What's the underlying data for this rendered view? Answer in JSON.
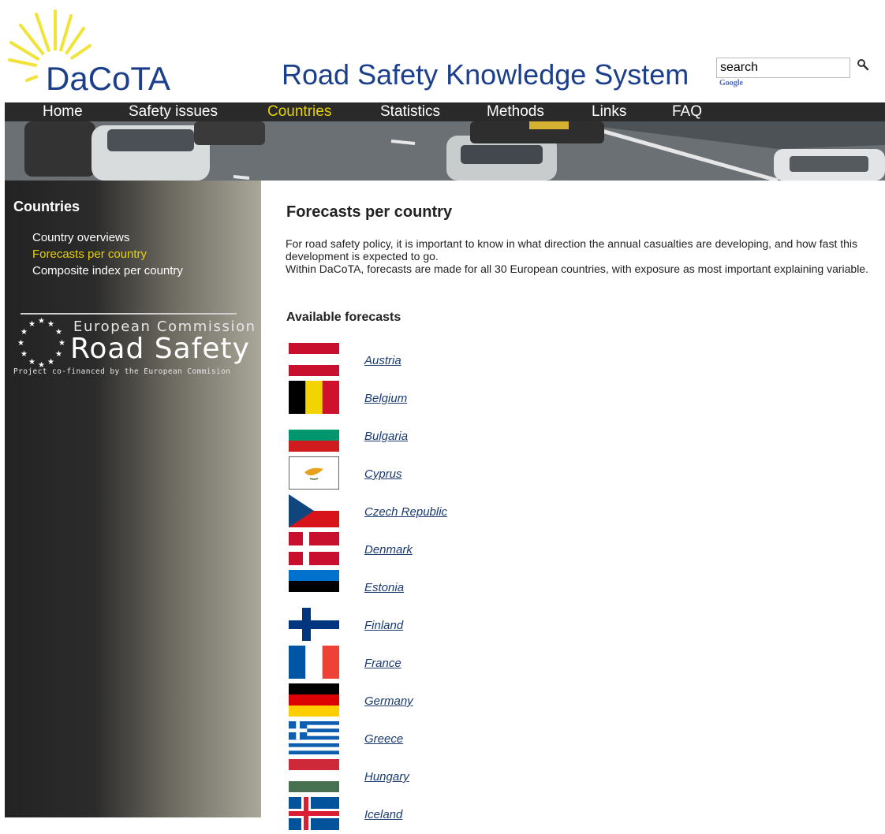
{
  "header": {
    "logo_text": "DaCoTA",
    "site_title": "Road Safety Knowledge System",
    "search": {
      "value": "search",
      "provider": "Google",
      "icon": "search-icon"
    }
  },
  "nav": {
    "items": [
      {
        "label": "Home"
      },
      {
        "label": "Safety issues"
      },
      {
        "label": "Countries",
        "active": true
      },
      {
        "label": "Statistics"
      },
      {
        "label": "Methods"
      },
      {
        "label": "Links"
      },
      {
        "label": "FAQ"
      }
    ],
    "active_color": "#e8d200"
  },
  "sidebar": {
    "title": "Countries",
    "links": [
      {
        "label": "Country overviews"
      },
      {
        "label": "Forecasts per country",
        "active": true
      },
      {
        "label": "Composite index per country"
      }
    ],
    "ec_logo": {
      "line1": "European Commission",
      "line2": "Road Safety",
      "line3": "Project co-financed by the European Commision"
    }
  },
  "main": {
    "title": "Forecasts per country",
    "intro_p1": "For road safety policy, it is important to know in what direction the annual casualties are developing, and how fast this development is expected to go.",
    "intro_p2": "Within DaCoTA, forecasts are made for all 30 European countries, with exposure as most important explaining variable.",
    "available_heading": "Available forecasts",
    "countries": [
      {
        "name": "Austria",
        "flag": "austria-flag"
      },
      {
        "name": "Belgium",
        "flag": "belgium-flag"
      },
      {
        "name": "Bulgaria",
        "flag": "bulgaria-flag"
      },
      {
        "name": "Cyprus",
        "flag": "cyprus-flag"
      },
      {
        "name": "Czech Republic",
        "flag": "czech-flag"
      },
      {
        "name": "Denmark",
        "flag": "denmark-flag"
      },
      {
        "name": "Estonia",
        "flag": "estonia-flag"
      },
      {
        "name": "Finland",
        "flag": "finland-flag"
      },
      {
        "name": "France",
        "flag": "france-flag"
      },
      {
        "name": "Germany",
        "flag": "germany-flag"
      },
      {
        "name": "Greece",
        "flag": "greece-flag"
      },
      {
        "name": "Hungary",
        "flag": "hungary-flag"
      },
      {
        "name": "Iceland",
        "flag": "iceland-flag"
      }
    ]
  }
}
